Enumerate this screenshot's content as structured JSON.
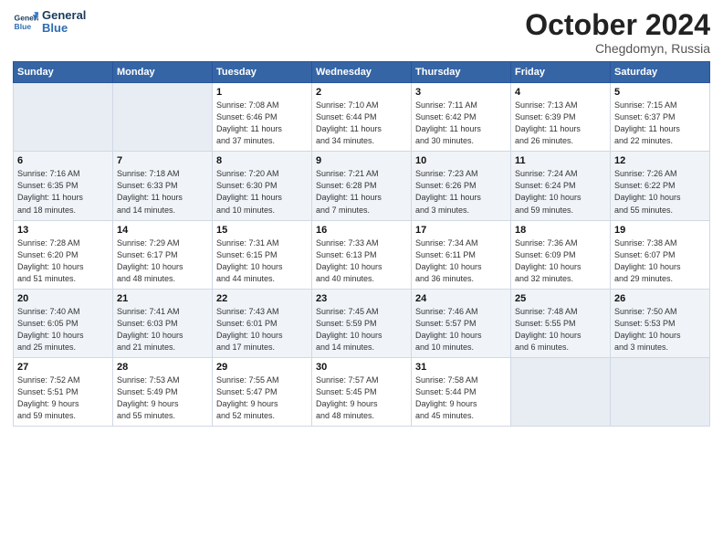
{
  "header": {
    "logo_line1": "General",
    "logo_line2": "Blue",
    "month": "October 2024",
    "location": "Chegdomyn, Russia"
  },
  "weekdays": [
    "Sunday",
    "Monday",
    "Tuesday",
    "Wednesday",
    "Thursday",
    "Friday",
    "Saturday"
  ],
  "rows": [
    [
      {
        "day": "",
        "info": ""
      },
      {
        "day": "",
        "info": ""
      },
      {
        "day": "1",
        "info": "Sunrise: 7:08 AM\nSunset: 6:46 PM\nDaylight: 11 hours\nand 37 minutes."
      },
      {
        "day": "2",
        "info": "Sunrise: 7:10 AM\nSunset: 6:44 PM\nDaylight: 11 hours\nand 34 minutes."
      },
      {
        "day": "3",
        "info": "Sunrise: 7:11 AM\nSunset: 6:42 PM\nDaylight: 11 hours\nand 30 minutes."
      },
      {
        "day": "4",
        "info": "Sunrise: 7:13 AM\nSunset: 6:39 PM\nDaylight: 11 hours\nand 26 minutes."
      },
      {
        "day": "5",
        "info": "Sunrise: 7:15 AM\nSunset: 6:37 PM\nDaylight: 11 hours\nand 22 minutes."
      }
    ],
    [
      {
        "day": "6",
        "info": "Sunrise: 7:16 AM\nSunset: 6:35 PM\nDaylight: 11 hours\nand 18 minutes."
      },
      {
        "day": "7",
        "info": "Sunrise: 7:18 AM\nSunset: 6:33 PM\nDaylight: 11 hours\nand 14 minutes."
      },
      {
        "day": "8",
        "info": "Sunrise: 7:20 AM\nSunset: 6:30 PM\nDaylight: 11 hours\nand 10 minutes."
      },
      {
        "day": "9",
        "info": "Sunrise: 7:21 AM\nSunset: 6:28 PM\nDaylight: 11 hours\nand 7 minutes."
      },
      {
        "day": "10",
        "info": "Sunrise: 7:23 AM\nSunset: 6:26 PM\nDaylight: 11 hours\nand 3 minutes."
      },
      {
        "day": "11",
        "info": "Sunrise: 7:24 AM\nSunset: 6:24 PM\nDaylight: 10 hours\nand 59 minutes."
      },
      {
        "day": "12",
        "info": "Sunrise: 7:26 AM\nSunset: 6:22 PM\nDaylight: 10 hours\nand 55 minutes."
      }
    ],
    [
      {
        "day": "13",
        "info": "Sunrise: 7:28 AM\nSunset: 6:20 PM\nDaylight: 10 hours\nand 51 minutes."
      },
      {
        "day": "14",
        "info": "Sunrise: 7:29 AM\nSunset: 6:17 PM\nDaylight: 10 hours\nand 48 minutes."
      },
      {
        "day": "15",
        "info": "Sunrise: 7:31 AM\nSunset: 6:15 PM\nDaylight: 10 hours\nand 44 minutes."
      },
      {
        "day": "16",
        "info": "Sunrise: 7:33 AM\nSunset: 6:13 PM\nDaylight: 10 hours\nand 40 minutes."
      },
      {
        "day": "17",
        "info": "Sunrise: 7:34 AM\nSunset: 6:11 PM\nDaylight: 10 hours\nand 36 minutes."
      },
      {
        "day": "18",
        "info": "Sunrise: 7:36 AM\nSunset: 6:09 PM\nDaylight: 10 hours\nand 32 minutes."
      },
      {
        "day": "19",
        "info": "Sunrise: 7:38 AM\nSunset: 6:07 PM\nDaylight: 10 hours\nand 29 minutes."
      }
    ],
    [
      {
        "day": "20",
        "info": "Sunrise: 7:40 AM\nSunset: 6:05 PM\nDaylight: 10 hours\nand 25 minutes."
      },
      {
        "day": "21",
        "info": "Sunrise: 7:41 AM\nSunset: 6:03 PM\nDaylight: 10 hours\nand 21 minutes."
      },
      {
        "day": "22",
        "info": "Sunrise: 7:43 AM\nSunset: 6:01 PM\nDaylight: 10 hours\nand 17 minutes."
      },
      {
        "day": "23",
        "info": "Sunrise: 7:45 AM\nSunset: 5:59 PM\nDaylight: 10 hours\nand 14 minutes."
      },
      {
        "day": "24",
        "info": "Sunrise: 7:46 AM\nSunset: 5:57 PM\nDaylight: 10 hours\nand 10 minutes."
      },
      {
        "day": "25",
        "info": "Sunrise: 7:48 AM\nSunset: 5:55 PM\nDaylight: 10 hours\nand 6 minutes."
      },
      {
        "day": "26",
        "info": "Sunrise: 7:50 AM\nSunset: 5:53 PM\nDaylight: 10 hours\nand 3 minutes."
      }
    ],
    [
      {
        "day": "27",
        "info": "Sunrise: 7:52 AM\nSunset: 5:51 PM\nDaylight: 9 hours\nand 59 minutes."
      },
      {
        "day": "28",
        "info": "Sunrise: 7:53 AM\nSunset: 5:49 PM\nDaylight: 9 hours\nand 55 minutes."
      },
      {
        "day": "29",
        "info": "Sunrise: 7:55 AM\nSunset: 5:47 PM\nDaylight: 9 hours\nand 52 minutes."
      },
      {
        "day": "30",
        "info": "Sunrise: 7:57 AM\nSunset: 5:45 PM\nDaylight: 9 hours\nand 48 minutes."
      },
      {
        "day": "31",
        "info": "Sunrise: 7:58 AM\nSunset: 5:44 PM\nDaylight: 9 hours\nand 45 minutes."
      },
      {
        "day": "",
        "info": ""
      },
      {
        "day": "",
        "info": ""
      }
    ]
  ]
}
